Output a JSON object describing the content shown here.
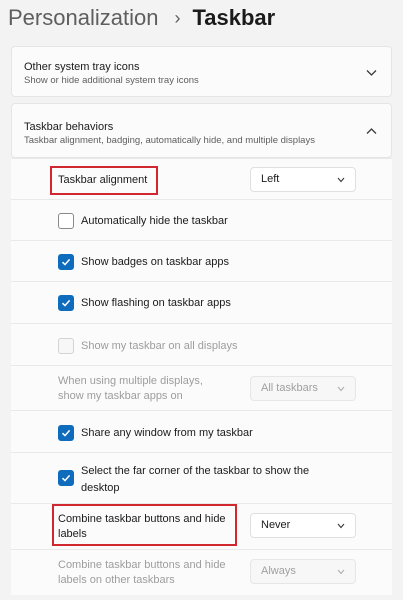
{
  "breadcrumb": {
    "parent": "Personalization",
    "separator": "›",
    "current": "Taskbar"
  },
  "other_tray": {
    "title": "Other system tray icons",
    "subtitle": "Show or hide additional system tray icons",
    "chevron_icon": "chevron-down-icon"
  },
  "behaviors": {
    "title": "Taskbar behaviors",
    "subtitle": "Taskbar alignment, badging, automatically hide, and multiple displays",
    "chevron_icon": "chevron-up-icon",
    "alignment": {
      "label": "Taskbar alignment",
      "value": "Left"
    },
    "auto_hide": {
      "label": "Automatically hide the taskbar",
      "checked": false
    },
    "badges": {
      "label": "Show badges on taskbar apps",
      "checked": true
    },
    "flashing": {
      "label": "Show flashing on taskbar apps",
      "checked": true
    },
    "all_displays": {
      "label": "Show my taskbar on all displays",
      "checked": false,
      "disabled": true
    },
    "multi_display": {
      "label_line1": "When using multiple displays,",
      "label_line2": "show my taskbar apps on",
      "value": "All taskbars"
    },
    "share_window": {
      "label": "Share any window from my taskbar",
      "checked": true
    },
    "far_corner": {
      "label_line1": "Select the far corner of the taskbar to show the",
      "label_line2": "desktop",
      "checked": true
    },
    "combine": {
      "label_line1": "Combine taskbar buttons and hide",
      "label_line2": "labels",
      "value": "Never"
    },
    "combine_other": {
      "label_line1": "Combine taskbar buttons and hide",
      "label_line2": "labels on other taskbars",
      "value": "Always"
    }
  },
  "colors": {
    "accent": "#0f6cbd",
    "highlight_box": "#d0282e"
  }
}
